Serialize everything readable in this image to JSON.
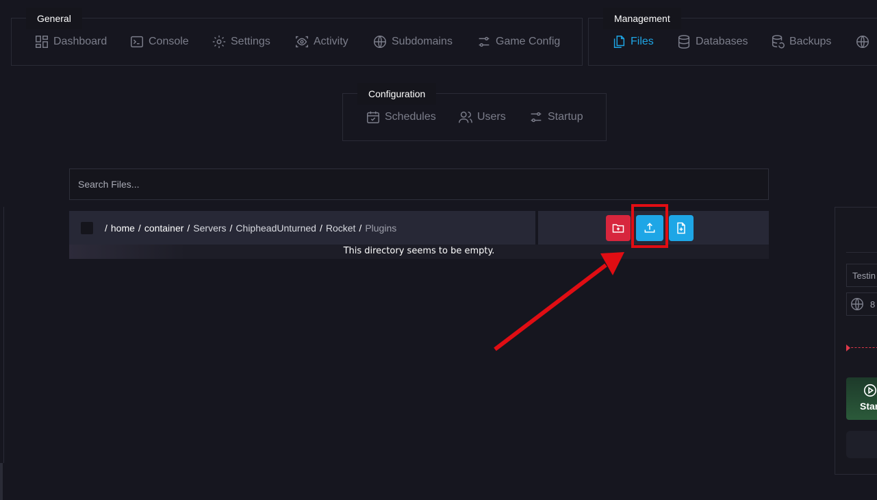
{
  "general": {
    "title": "General",
    "items": [
      {
        "label": "Dashboard",
        "icon": "dashboard-icon"
      },
      {
        "label": "Console",
        "icon": "terminal-icon"
      },
      {
        "label": "Settings",
        "icon": "gear-icon"
      },
      {
        "label": "Activity",
        "icon": "activity-eye-icon"
      },
      {
        "label": "Subdomains",
        "icon": "globe-icon"
      },
      {
        "label": "Game Config",
        "icon": "sliders-icon"
      }
    ]
  },
  "management": {
    "title": "Management",
    "items": [
      {
        "label": "Files",
        "icon": "files-icon",
        "active": true
      },
      {
        "label": "Databases",
        "icon": "database-icon"
      },
      {
        "label": "Backups",
        "icon": "backup-icon"
      },
      {
        "label": "",
        "icon": "globe-icon"
      }
    ]
  },
  "configuration": {
    "title": "Configuration",
    "items": [
      {
        "label": "Schedules",
        "icon": "calendar-check-icon"
      },
      {
        "label": "Users",
        "icon": "users-icon"
      },
      {
        "label": "Startup",
        "icon": "sliders-icon"
      }
    ]
  },
  "search": {
    "placeholder": "Search Files..."
  },
  "breadcrumb": {
    "separator": "/",
    "segments": [
      "home",
      "container",
      "Servers",
      "ChipheadUnturned",
      "Rocket",
      "Plugins"
    ]
  },
  "actions": {
    "new_folder": {
      "icon": "folder-plus-icon",
      "color": "#d7263d"
    },
    "upload": {
      "icon": "upload-icon",
      "color": "#1ea6e6"
    },
    "new_file": {
      "icon": "file-plus-icon",
      "color": "#1ea6e6"
    }
  },
  "empty_message": "This directory seems to be empty.",
  "right_panel": {
    "name_value": "Testin",
    "address_value": "8",
    "start_label": "Star"
  },
  "colors": {
    "accent": "#1ea6e6",
    "danger": "#d7263d",
    "annotation": "#e00d13"
  }
}
